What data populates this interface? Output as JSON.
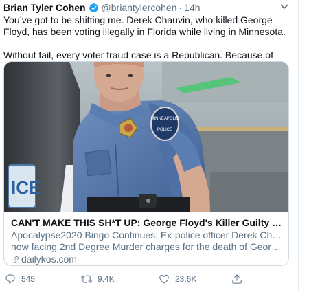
{
  "tweet": {
    "author": {
      "display_name": "Brian Tyler Cohen",
      "verified_icon": "verified-badge-icon",
      "handle": "@briantylercohen",
      "separator": "·",
      "time": "14h"
    },
    "menu_icon": "chevron-down-icon",
    "text_lines": [
      "You’ve got to be shitting me. Derek Chauvin, who killed George Floyd, has been voting illegally in Florida while living in Minnesota.",
      "Without fail, every voter fraud case is a Republican. Because of course."
    ],
    "card": {
      "image": {
        "description_icon": "photo",
        "patch_text": "MINNEAPOLIS",
        "patch_sub": "POLICE",
        "plate_text": "ICE"
      },
      "title": "CAN'T MAKE THIS SH*T UP: George Floyd's Killer Guilty Of Voter Fra...",
      "description_line1": "Apocalypse2020 Bingo Continues: Ex-police officer Derek Chauvin,",
      "description_line2": "now facing 2nd Degree Murder charges for the death of George Floy...",
      "domain_icon": "link-icon",
      "domain": "dailykos.com"
    },
    "actions": {
      "reply": {
        "icon": "reply-icon",
        "count": "545"
      },
      "retweet": {
        "icon": "retweet-icon",
        "count": "9.4K"
      },
      "like": {
        "icon": "heart-icon",
        "count": "23.6K"
      },
      "share": {
        "icon": "share-icon"
      }
    }
  },
  "colors": {
    "text": "#0f1419",
    "secondary": "#5b7083",
    "verified": "#1da1f2",
    "border": "#cfd9de"
  }
}
